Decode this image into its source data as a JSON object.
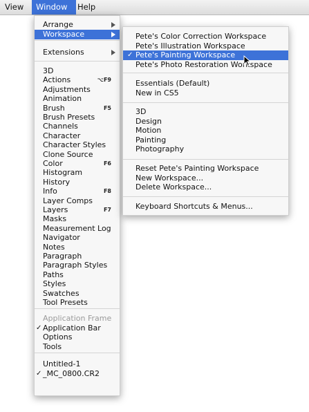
{
  "menubar": {
    "items": [
      "View",
      "Window",
      "Help"
    ],
    "active": "Window"
  },
  "main_menu": {
    "group1": [
      {
        "label": "Arrange",
        "submenu": true
      },
      {
        "label": "Workspace",
        "submenu": true,
        "highlighted": true
      }
    ],
    "group2": [
      {
        "label": "Extensions",
        "submenu": true
      }
    ],
    "group3": [
      {
        "label": "3D"
      },
      {
        "label": "Actions",
        "shortcut": "⌥F9"
      },
      {
        "label": "Adjustments"
      },
      {
        "label": "Animation"
      },
      {
        "label": "Brush",
        "shortcut": "F5"
      },
      {
        "label": "Brush Presets"
      },
      {
        "label": "Channels"
      },
      {
        "label": "Character"
      },
      {
        "label": "Character Styles"
      },
      {
        "label": "Clone Source"
      },
      {
        "label": "Color",
        "shortcut": "F6"
      },
      {
        "label": "Histogram"
      },
      {
        "label": "History"
      },
      {
        "label": "Info",
        "shortcut": "F8"
      },
      {
        "label": "Layer Comps"
      },
      {
        "label": "Layers",
        "shortcut": "F7"
      },
      {
        "label": "Masks"
      },
      {
        "label": "Measurement Log"
      },
      {
        "label": "Navigator"
      },
      {
        "label": "Notes"
      },
      {
        "label": "Paragraph"
      },
      {
        "label": "Paragraph Styles"
      },
      {
        "label": "Paths"
      },
      {
        "label": "Styles"
      },
      {
        "label": "Swatches"
      },
      {
        "label": "Tool Presets"
      }
    ],
    "group4": [
      {
        "label": "Application Frame",
        "disabled": true
      },
      {
        "label": "Application Bar",
        "checked": true
      },
      {
        "label": "Options"
      },
      {
        "label": "Tools"
      }
    ],
    "group5": [
      {
        "label": "Untitled-1"
      },
      {
        "label": "_MC_0800.CR2",
        "checked": true
      }
    ]
  },
  "workspace_menu": {
    "group1": [
      {
        "label": "Pete's Color Correction Workspace"
      },
      {
        "label": "Pete's Illustration Workspace"
      },
      {
        "label": "Pete's Painting Workspace",
        "checked": true,
        "highlighted": true
      },
      {
        "label": "Pete's Photo Restoration Workspace"
      }
    ],
    "group2": [
      {
        "label": "Essentials (Default)"
      },
      {
        "label": "New in CS5"
      }
    ],
    "group3": [
      {
        "label": "3D"
      },
      {
        "label": "Design"
      },
      {
        "label": "Motion"
      },
      {
        "label": "Painting"
      },
      {
        "label": "Photography"
      }
    ],
    "group4": [
      {
        "label": "Reset Pete's Painting Workspace"
      },
      {
        "label": "New Workspace..."
      },
      {
        "label": "Delete Workspace..."
      }
    ],
    "group5": [
      {
        "label": "Keyboard Shortcuts & Menus..."
      }
    ]
  },
  "check_glyph": "✓",
  "colors": {
    "highlight": "#3d72d8",
    "menu_bg": "#f7f7f7",
    "disabled_text": "#9a9a9a"
  },
  "icons": {
    "submenu": "triangle-right-icon",
    "cursor": "arrow-pointer-icon"
  }
}
